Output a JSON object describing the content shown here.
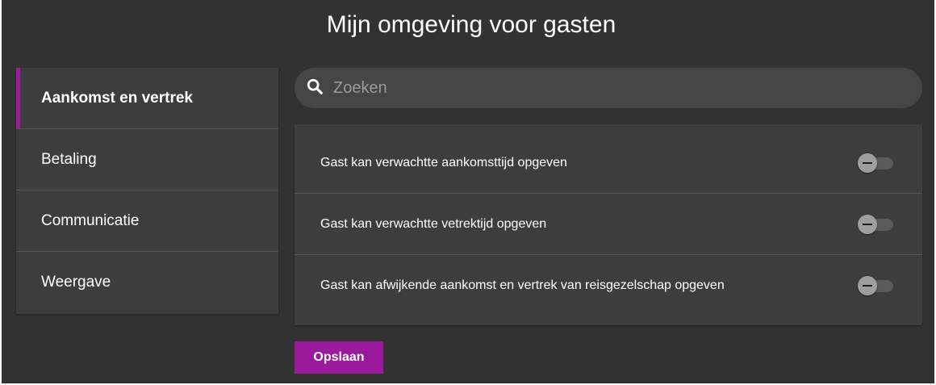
{
  "page": {
    "title": "Mijn omgeving voor gasten"
  },
  "sidebar": {
    "items": [
      {
        "label": "Aankomst en vertrek",
        "active": true
      },
      {
        "label": "Betaling"
      },
      {
        "label": "Communicatie"
      },
      {
        "label": "Weergave"
      }
    ]
  },
  "search": {
    "placeholder": "Zoeken",
    "value": "",
    "icon": "search-icon"
  },
  "settings": {
    "rows": [
      {
        "label": "Gast kan verwachtte aankomsttijd opgeven",
        "enabled": false
      },
      {
        "label": "Gast kan verwachtte vetrektijd opgeven",
        "enabled": false
      },
      {
        "label": "Gast kan afwijkende aankomst en vertrek van reisgezelschap opgeven",
        "enabled": false
      }
    ]
  },
  "actions": {
    "save_label": "Opslaan"
  },
  "colors": {
    "accent": "#9b1a9b",
    "background": "#323232",
    "panel": "#3d3d3d"
  }
}
